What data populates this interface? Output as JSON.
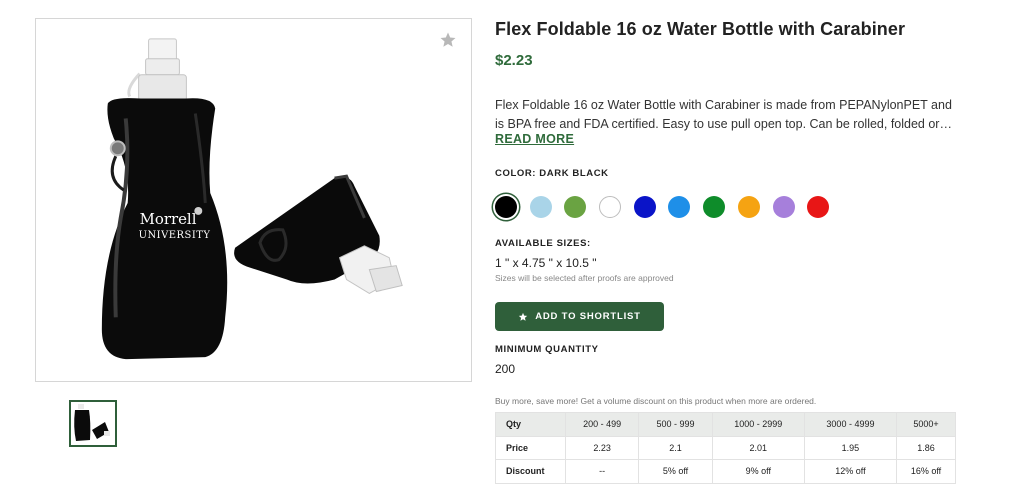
{
  "product": {
    "title": "Flex Foldable 16 oz Water Bottle with Carabiner",
    "price": "$2.23",
    "description": "Flex Foldable 16 oz Water Bottle with Carabiner is made from PEPANylonPET and is BPA free and FDA certified. Easy to use pull open top. Can be rolled, folded or…",
    "read_more": "READ MORE",
    "imprint": {
      "line1": "Morrell",
      "line2": "UNIVERSITY"
    }
  },
  "icons": {
    "favorite": "star-icon",
    "cart": "star-icon"
  },
  "color": {
    "label": "COLOR: DARK BLACK",
    "swatches": [
      {
        "name": "Dark Black",
        "hex": "#000000",
        "selected": true
      },
      {
        "name": "Light Blue",
        "hex": "#a9d4e8"
      },
      {
        "name": "Lime Green",
        "hex": "#6aa342"
      },
      {
        "name": "White",
        "hex": "#ffffff"
      },
      {
        "name": "Navy Blue",
        "hex": "#0a14c8"
      },
      {
        "name": "Blue",
        "hex": "#1e8fe8"
      },
      {
        "name": "Green",
        "hex": "#0e8c2a"
      },
      {
        "name": "Orange",
        "hex": "#f5a312"
      },
      {
        "name": "Purple",
        "hex": "#a67fdb"
      },
      {
        "name": "Red",
        "hex": "#e81616"
      }
    ]
  },
  "sizes": {
    "label": "AVAILABLE SIZES:",
    "value": "1 \" x 4.75 \" x 10.5 \"",
    "note": "Sizes will be selected after proofs are approved"
  },
  "actions": {
    "add_to_shortlist": "ADD TO SHORTLIST"
  },
  "minimum": {
    "label": "MINIMUM QUANTITY",
    "value": "200"
  },
  "pricing": {
    "promo": "Buy more, save more! Get a volume discount on this product when more are ordered.",
    "headers": [
      "Qty",
      "200 - 499",
      "500 - 999",
      "1000 - 2999",
      "3000 - 4999",
      "5000+"
    ],
    "rows": [
      [
        "Price",
        "2.23",
        "2.1",
        "2.01",
        "1.95",
        "1.86"
      ],
      [
        "Discount",
        "--",
        "5% off",
        "9% off",
        "12% off",
        "16% off"
      ]
    ]
  },
  "theme": {
    "accent": "#2f5f3a",
    "price_green": "#2f6b3b"
  }
}
